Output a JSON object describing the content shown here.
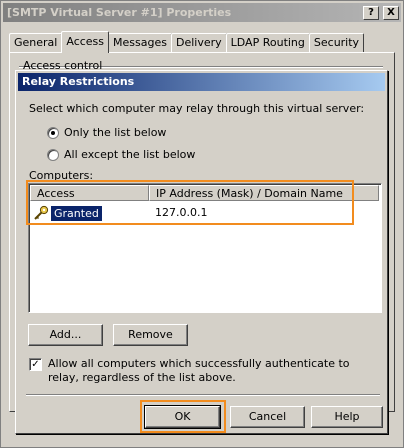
{
  "outer_window": {
    "title": "[SMTP Virtual Server #1] Properties",
    "help_glyph": "?",
    "close_glyph": "X",
    "tabs": [
      "General",
      "Access",
      "Messages",
      "Delivery",
      "LDAP Routing",
      "Security"
    ],
    "active_tab": "Access",
    "group_label": "Access control"
  },
  "dialog": {
    "title": "Relay Restrictions",
    "prompt": "Select which computer may relay through this virtual server:",
    "radio_only_list": "Only the list below",
    "radio_all_except": "All except the list below",
    "selected_radio": "only_list",
    "computers_label": "Computers:",
    "columns": [
      "Access",
      "IP Address (Mask) / Domain Name"
    ],
    "rows": [
      {
        "access": "Granted",
        "ip": "127.0.0.1",
        "icon": "key-icon",
        "selected": true
      }
    ],
    "add_button": "Add...",
    "remove_button": "Remove",
    "checkbox_checked": true,
    "checkbox_glyph": "✓",
    "checkbox_label": "Allow all computers which successfully authenticate to relay, regardless of the list above.",
    "ok_button": "OK",
    "cancel_button": "Cancel",
    "help_button": "Help"
  },
  "colors": {
    "highlight": "#f28c1e",
    "title_active": "#0a246a",
    "title_inactive": "#808080",
    "face": "#d4d0c8"
  }
}
